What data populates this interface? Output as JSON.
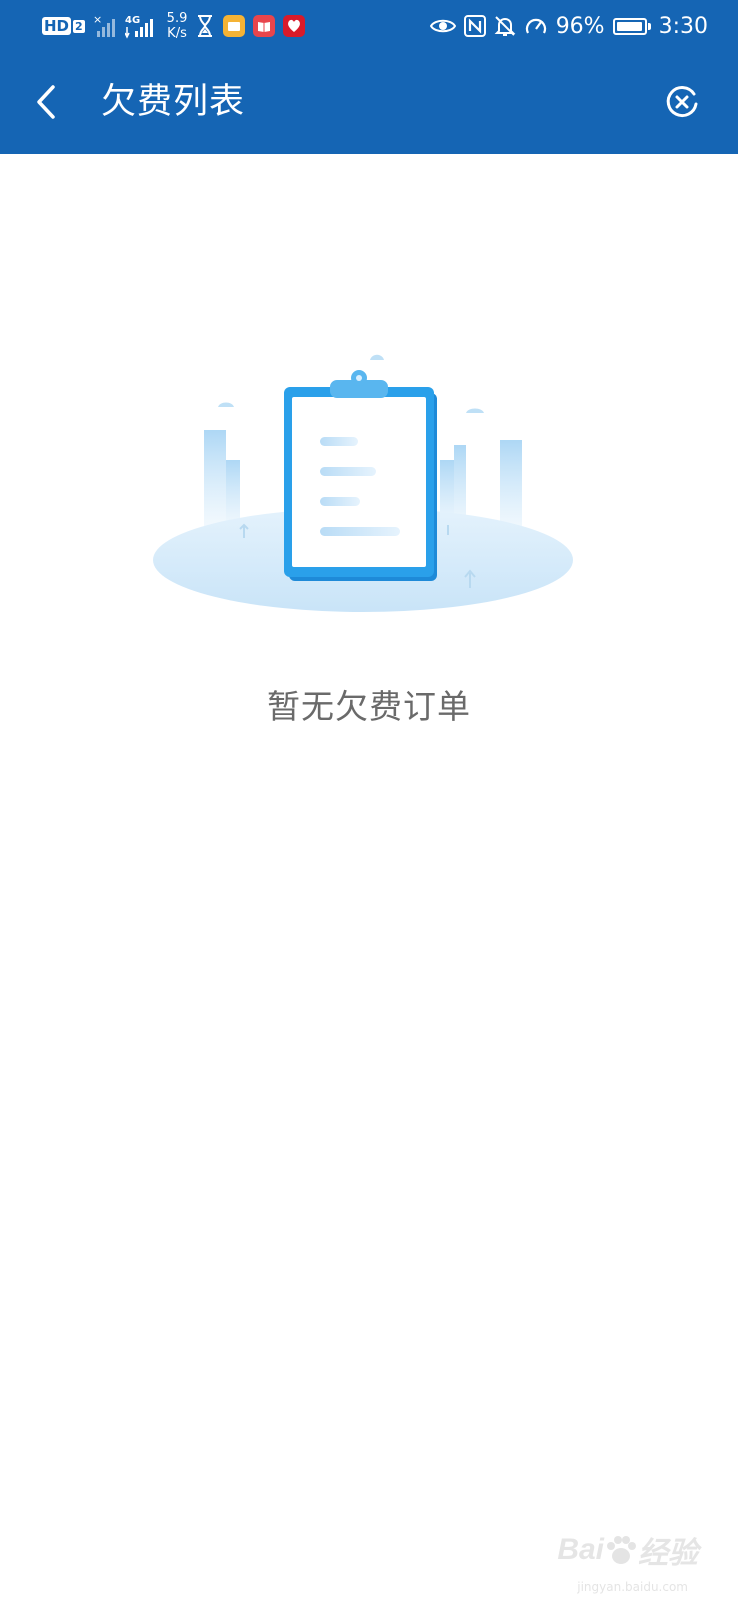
{
  "status_bar": {
    "hd_label": "HD",
    "hd_sim": "2",
    "sim1_label": "×",
    "network_type": "4G",
    "net_speed_value": "5.9",
    "net_speed_unit": "K/s",
    "battery_percent": "96%",
    "battery_level": 0.96,
    "time": "3:30"
  },
  "nav": {
    "title": "欠费列表"
  },
  "empty_state": {
    "message": "暂无欠费订单"
  },
  "watermark": {
    "brand_left": "Bai",
    "brand_right": "经验",
    "domain": "jingyan.baidu.com"
  },
  "colors": {
    "header": "#1565b4",
    "accent": "#2aa0ea",
    "message_text": "#6a6a6a"
  }
}
